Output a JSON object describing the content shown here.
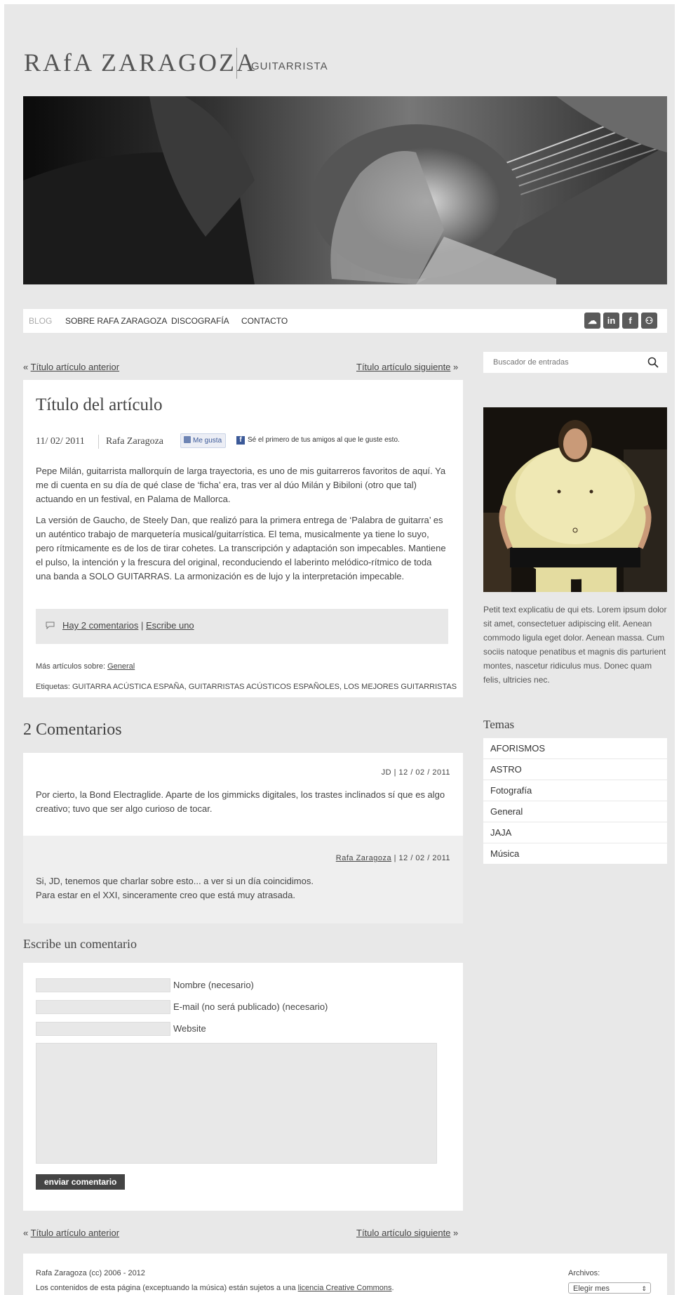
{
  "header": {
    "logo": "RAfA ZARAGOZA",
    "tagline": "GUITARRISTA"
  },
  "nav": {
    "items": [
      "BLOG",
      "SOBRE RAFA ZARAGOZA",
      "DISCOGRAFÍA",
      "CONTACTO"
    ],
    "active_index": 0,
    "social_icons": [
      "soundcloud-icon",
      "linkedin-icon",
      "facebook-icon",
      "myspace-icon"
    ],
    "social_labels": [
      "☁",
      "in",
      "f",
      "⚇"
    ]
  },
  "post_nav": {
    "prev_prefix": "« ",
    "prev": "Título artículo anterior",
    "next": "Título artículo siguiente",
    "next_suffix": " »"
  },
  "search": {
    "placeholder": "Buscador de entradas"
  },
  "article": {
    "title": "Título del artículo",
    "date": "11/ 02/ 2011",
    "author": "Rafa Zaragoza",
    "like_label": "Me gusta",
    "fb_text": "Sé el primero de tus amigos al que le guste esto.",
    "paragraphs": [
      "Pepe Milán, guitarrista mallorquín de larga trayectoria, es uno de mis guitarreros favoritos de aquí. Ya me di cuenta en su día de qué clase de ‘ficha’ era, tras ver al dúo Milán y Bibiloni (otro que tal) actuando en un festival, en Palama de Mallorca.",
      "La versión de Gaucho, de Steely Dan, que realizó para la primera entrega de ‘Palabra de guitarra’ es un auténtico trabajo de marquetería musical/guitarrística. El tema, musicalmente ya tiene lo suyo, pero rítmicamente es de los de tirar cohetes. La transcripción y adaptación son impecables. Mantiene el pulso, la intención y la frescura del original, reconduciendo el laberinto melódico-rítmico de toda una banda a SOLO GUITARRAS. La armonización es de lujo y la interpretación impecable."
    ],
    "comments_link": "Hay 2 comentarios",
    "comments_sep": " | ",
    "write_link": "Escribe uno",
    "more_label": "Más artículos sobre: ",
    "more_category": "General",
    "tags_label": "Etiquetas: ",
    "tags": "GUITARRA ACÚSTICA ESPAÑA, GUITARRISTAS ACÚSTICOS ESPAÑOLES, LOS MEJORES GUITARRISTAS"
  },
  "sidebar": {
    "bio": "Petit text explicatiu de qui ets. Lorem ipsum dolor sit amet, consectetuer adipiscing elit. Aenean commodo ligula eget dolor. Aenean massa. Cum sociis natoque penatibus et magnis dis parturient montes, nascetur ridiculus mus. Donec quam felis, ultricies nec.",
    "temas_title": "Temas",
    "temas": [
      "AFORISMOS",
      "ASTRO",
      "Fotografía",
      "General",
      "JAJA",
      "Música"
    ]
  },
  "comments": {
    "title": "2 Comentarios",
    "items": [
      {
        "author": "JD",
        "date": " | 12 / 02 / 2011",
        "lines": [
          "Por cierto, la Bond Electraglide. Aparte de los gimmicks digitales, los trastes inclinados sí que es algo creativo; tuvo que ser algo curioso de tocar."
        ]
      },
      {
        "author": "Rafa Zaragoza",
        "date": " | 12 / 02 / 2011",
        "lines": [
          "Si, JD, tenemos que charlar sobre esto... a ver si un día coincidimos.",
          "Para estar en el XXI, sinceramente creo que está muy atrasada."
        ]
      }
    ]
  },
  "form": {
    "title": "Escribe un comentario",
    "name_label": "Nombre (necesario)",
    "email_label": "E-mail (no será publicado) (necesario)",
    "website_label": "Website",
    "submit": "enviar comentario"
  },
  "footer": {
    "copyright": "Rafa Zaragoza (cc) 2006 - 2012",
    "license_text": "Los contenidos de esta página (exceptuando la música) están sujetos a una ",
    "license_link": "licencia Creative Commons",
    "license_end": ".",
    "archives_label": "Archivos:",
    "archives_select": "Elegir mes"
  }
}
